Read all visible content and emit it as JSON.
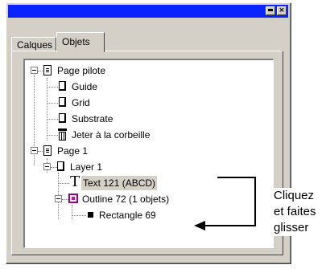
{
  "tabs": [
    {
      "label": "Calques",
      "active": false
    },
    {
      "label": "Objets",
      "active": true
    }
  ],
  "tree": {
    "page_pilote": "Page pilote",
    "guide": "Guide",
    "grid": "Grid",
    "substrate": "Substrate",
    "trash": "Jeter à la corbeille",
    "page1": "Page 1",
    "layer1": "Layer 1",
    "text121": "Text 121 (ABCD)",
    "outline72": "Outline 72 (1 objets)",
    "rectangle69": "Rectangle 69"
  },
  "annotation": {
    "line1": "Cliquez",
    "line2": "et faites",
    "line3": "glisser"
  },
  "colors": {
    "titlebar": "#0a24ff",
    "face": "#d4d0c8",
    "group_icon": "#9a0080"
  }
}
